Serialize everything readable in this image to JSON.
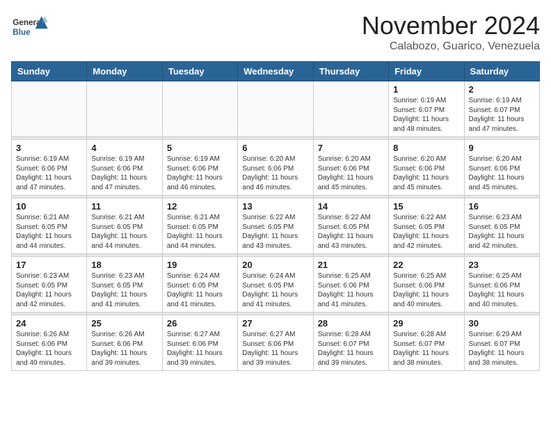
{
  "header": {
    "logo_general": "General",
    "logo_blue": "Blue",
    "month": "November 2024",
    "location": "Calabozo, Guarico, Venezuela"
  },
  "weekdays": [
    "Sunday",
    "Monday",
    "Tuesday",
    "Wednesday",
    "Thursday",
    "Friday",
    "Saturday"
  ],
  "weeks": [
    [
      {
        "day": "",
        "info": ""
      },
      {
        "day": "",
        "info": ""
      },
      {
        "day": "",
        "info": ""
      },
      {
        "day": "",
        "info": ""
      },
      {
        "day": "",
        "info": ""
      },
      {
        "day": "1",
        "info": "Sunrise: 6:19 AM\nSunset: 6:07 PM\nDaylight: 11 hours\nand 48 minutes."
      },
      {
        "day": "2",
        "info": "Sunrise: 6:19 AM\nSunset: 6:07 PM\nDaylight: 11 hours\nand 47 minutes."
      }
    ],
    [
      {
        "day": "3",
        "info": "Sunrise: 6:19 AM\nSunset: 6:06 PM\nDaylight: 11 hours\nand 47 minutes."
      },
      {
        "day": "4",
        "info": "Sunrise: 6:19 AM\nSunset: 6:06 PM\nDaylight: 11 hours\nand 47 minutes."
      },
      {
        "day": "5",
        "info": "Sunrise: 6:19 AM\nSunset: 6:06 PM\nDaylight: 11 hours\nand 46 minutes."
      },
      {
        "day": "6",
        "info": "Sunrise: 6:20 AM\nSunset: 6:06 PM\nDaylight: 11 hours\nand 46 minutes."
      },
      {
        "day": "7",
        "info": "Sunrise: 6:20 AM\nSunset: 6:06 PM\nDaylight: 11 hours\nand 45 minutes."
      },
      {
        "day": "8",
        "info": "Sunrise: 6:20 AM\nSunset: 6:06 PM\nDaylight: 11 hours\nand 45 minutes."
      },
      {
        "day": "9",
        "info": "Sunrise: 6:20 AM\nSunset: 6:06 PM\nDaylight: 11 hours\nand 45 minutes."
      }
    ],
    [
      {
        "day": "10",
        "info": "Sunrise: 6:21 AM\nSunset: 6:05 PM\nDaylight: 11 hours\nand 44 minutes."
      },
      {
        "day": "11",
        "info": "Sunrise: 6:21 AM\nSunset: 6:05 PM\nDaylight: 11 hours\nand 44 minutes."
      },
      {
        "day": "12",
        "info": "Sunrise: 6:21 AM\nSunset: 6:05 PM\nDaylight: 11 hours\nand 44 minutes."
      },
      {
        "day": "13",
        "info": "Sunrise: 6:22 AM\nSunset: 6:05 PM\nDaylight: 11 hours\nand 43 minutes."
      },
      {
        "day": "14",
        "info": "Sunrise: 6:22 AM\nSunset: 6:05 PM\nDaylight: 11 hours\nand 43 minutes."
      },
      {
        "day": "15",
        "info": "Sunrise: 6:22 AM\nSunset: 6:05 PM\nDaylight: 11 hours\nand 42 minutes."
      },
      {
        "day": "16",
        "info": "Sunrise: 6:23 AM\nSunset: 6:05 PM\nDaylight: 11 hours\nand 42 minutes."
      }
    ],
    [
      {
        "day": "17",
        "info": "Sunrise: 6:23 AM\nSunset: 6:05 PM\nDaylight: 11 hours\nand 42 minutes."
      },
      {
        "day": "18",
        "info": "Sunrise: 6:23 AM\nSunset: 6:05 PM\nDaylight: 11 hours\nand 41 minutes."
      },
      {
        "day": "19",
        "info": "Sunrise: 6:24 AM\nSunset: 6:05 PM\nDaylight: 11 hours\nand 41 minutes."
      },
      {
        "day": "20",
        "info": "Sunrise: 6:24 AM\nSunset: 6:05 PM\nDaylight: 11 hours\nand 41 minutes."
      },
      {
        "day": "21",
        "info": "Sunrise: 6:25 AM\nSunset: 6:06 PM\nDaylight: 11 hours\nand 41 minutes."
      },
      {
        "day": "22",
        "info": "Sunrise: 6:25 AM\nSunset: 6:06 PM\nDaylight: 11 hours\nand 40 minutes."
      },
      {
        "day": "23",
        "info": "Sunrise: 6:25 AM\nSunset: 6:06 PM\nDaylight: 11 hours\nand 40 minutes."
      }
    ],
    [
      {
        "day": "24",
        "info": "Sunrise: 6:26 AM\nSunset: 6:06 PM\nDaylight: 11 hours\nand 40 minutes."
      },
      {
        "day": "25",
        "info": "Sunrise: 6:26 AM\nSunset: 6:06 PM\nDaylight: 11 hours\nand 39 minutes."
      },
      {
        "day": "26",
        "info": "Sunrise: 6:27 AM\nSunset: 6:06 PM\nDaylight: 11 hours\nand 39 minutes."
      },
      {
        "day": "27",
        "info": "Sunrise: 6:27 AM\nSunset: 6:06 PM\nDaylight: 11 hours\nand 39 minutes."
      },
      {
        "day": "28",
        "info": "Sunrise: 6:28 AM\nSunset: 6:07 PM\nDaylight: 11 hours\nand 39 minutes."
      },
      {
        "day": "29",
        "info": "Sunrise: 6:28 AM\nSunset: 6:07 PM\nDaylight: 11 hours\nand 38 minutes."
      },
      {
        "day": "30",
        "info": "Sunrise: 6:29 AM\nSunset: 6:07 PM\nDaylight: 11 hours\nand 38 minutes."
      }
    ]
  ]
}
